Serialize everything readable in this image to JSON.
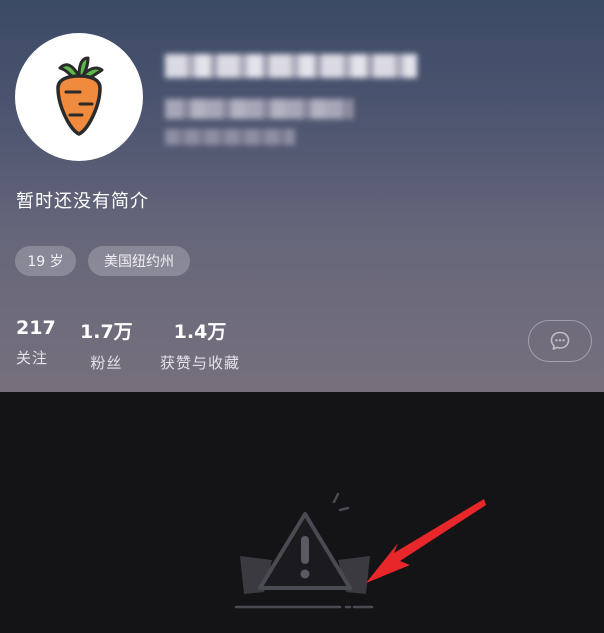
{
  "profile": {
    "bio": "暂时还没有简介",
    "tags": {
      "age": "19 岁",
      "location": "美国纽约州"
    },
    "stats": [
      {
        "value": "217",
        "label": "关注"
      },
      {
        "value": "1.7万",
        "label": "粉丝"
      },
      {
        "value": "1.4万",
        "label": "获赞与收藏"
      }
    ]
  },
  "icons": {
    "avatar": "carrot-icon",
    "message": "chat-bubble-icon",
    "error": "warning-triangle-icon",
    "annotation": "red-arrow-icon"
  },
  "colors": {
    "header_top": "#3b4a66",
    "header_bottom": "#76707c",
    "page_bg": "#141416",
    "carrot": "#f08a3c",
    "arrow": "#e8272b"
  }
}
